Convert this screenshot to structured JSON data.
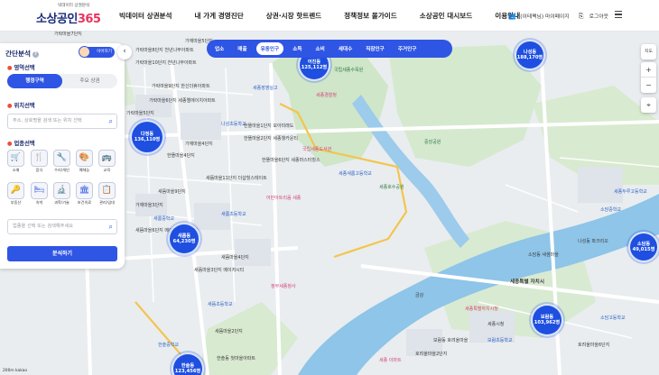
{
  "header": {
    "logo_sub": "빅데이터 상권분석",
    "logo_main": "소상공인",
    "logo_num": "365",
    "nav": [
      "빅데이터 상권분석",
      "내 가게 경영진단",
      "상권·시장 핫트렌드",
      "정책정보 몰가이드",
      "소상공인 대시보드",
      "이용안내"
    ],
    "user_label": "(이테팩님) 마이페이지",
    "logout_label": "로그아웃"
  },
  "category_tabs": [
    "업소",
    "매출",
    "유동인구",
    "소득",
    "소비",
    "세대수",
    "직장인구",
    "주거인구"
  ],
  "active_tab": "유동인구",
  "panel": {
    "title": "간단분석",
    "helper": "이어하기",
    "collapse": "‹",
    "area_section": "영역선택",
    "area_options": [
      "행정구역",
      "주요 상권"
    ],
    "location_section": "위치선택",
    "location_placeholder": "주소, 상호명을 검색 또는 위치 선택",
    "industry_section": "업종선택",
    "industries": [
      {
        "label": "소매",
        "icon": "🛒"
      },
      {
        "label": "음식",
        "icon": "🍴"
      },
      {
        "label": "수리/개인",
        "icon": "🔧"
      },
      {
        "label": "예체능",
        "icon": "🎨"
      },
      {
        "label": "교육",
        "icon": "🚌"
      },
      {
        "label": "부동산",
        "icon": "🔑"
      },
      {
        "label": "숙박",
        "icon": "🛏"
      },
      {
        "label": "과학/기술",
        "icon": "🔬"
      },
      {
        "label": "보건의료",
        "icon": "🏛"
      },
      {
        "label": "관리/임대",
        "icon": "📋"
      }
    ],
    "industry_placeholder": "업종을 선택 또는 검색해주세요",
    "apply_label": "분석하기"
  },
  "bubbles": [
    {
      "name": "나성동",
      "value": "188,170명"
    },
    {
      "name": "어진동",
      "value": "125,112명"
    },
    {
      "name": "다정동",
      "value": "136,110명"
    },
    {
      "name": "새롬동",
      "value": "64,230명"
    },
    {
      "name": "소담동",
      "value": "49,015명"
    },
    {
      "name": "보람동",
      "value": "103,962명"
    },
    {
      "name": "한솔동",
      "value": "123,456명"
    }
  ],
  "map_labels": {
    "apt1": "가락마을7단지",
    "apt2": "가락마을8단지 천년나무아파트",
    "apt3": "가락마을10단지 천년나무아파트",
    "apt4": "가락마을9단지 한신더휴아파트",
    "apt5": "가락마을6단지 세종엘에이치아파트",
    "apt6": "가락마을5단지",
    "apt7": "한뜰마을1단지 모아미래도",
    "apt8": "한뜰마을2단지 세종웰카운티",
    "apt9": "한뜰마을4단지",
    "apt10": "한뜰마을6단지 세종마스터힐스",
    "apt11": "새뜸마을11단지 더샵힐스테이트",
    "apt12": "새뜸마을9단지",
    "apt13": "새뜸마을6단지 메이저시티아파트",
    "apt14": "새뜸마을4단지",
    "apt15": "새뜸마을3단지 메이저시티",
    "apt16": "새뜸마을2단지",
    "apt17": "한솔동 첫마을아파트",
    "school1": "세종장영실고",
    "school2": "나성초등학교",
    "school3": "세종새롬고등학교",
    "school4": "새롬중학교",
    "school5": "새롬초등학교",
    "school6": "세종두루고등학교",
    "school7": "새뜸초등학교",
    "school8": "한솔중학교",
    "school9": "보람초등학교",
    "school10": "소담고등학교",
    "school11": "소담중학교",
    "park1": "세종호수공원",
    "park2": "국립세종수목원",
    "park3": "중앙공원",
    "office1": "세종특별자치시청",
    "office2": "세종특별 자치시",
    "office3": "정부세종청사",
    "office4": "세종시청",
    "bank1": "세종경찰청",
    "bank2": "국립세종도서관",
    "mall1": "어반아트리움 세종",
    "river1": "금강",
    "store1": "세종 이마트",
    "apt18": "가재마을5단지",
    "apt19": "가재마을4단지",
    "apt20": "가재마을3단지",
    "apt21": "나성동 파크리오",
    "apt22": "소담동 새샘마을",
    "apt23": "보람동 호려울마을",
    "apt24": "호려울마을2단지",
    "apt25": "호려울마을6단지"
  },
  "map_controls": {
    "map": "지도",
    "zoom_in": "+",
    "zoom_out": "−",
    "locate": "⌖"
  },
  "scale_label": "200m  kakao"
}
